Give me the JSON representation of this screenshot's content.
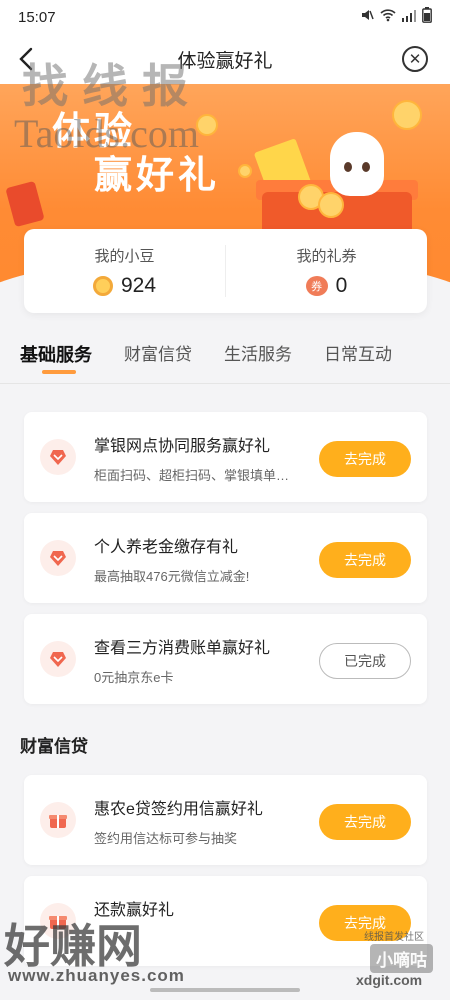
{
  "status_bar": {
    "time": "15:07",
    "battery": "▮"
  },
  "header": {
    "title": "体验赢好礼"
  },
  "banner": {
    "line1": "体验",
    "line2": "赢好礼"
  },
  "points": {
    "beans_label": "我的小豆",
    "beans_value": "924",
    "coupons_label": "我的礼券",
    "coupons_value": "0",
    "coupon_icon_text": "券"
  },
  "tabs": [
    "基础服务",
    "财富信贷",
    "生活服务",
    "日常互动"
  ],
  "tasks_basic": [
    {
      "title": "掌银网点协同服务赢好礼",
      "sub": "柜面扫码、超柜扫码、掌银填单…",
      "button": "去完成",
      "done": false
    },
    {
      "title": "个人养老金缴存有礼",
      "sub": "最高抽取476元微信立减金!",
      "button": "去完成",
      "done": false
    },
    {
      "title": "查看三方消费账单赢好礼",
      "sub": "0元抽京东e卡",
      "button": "已完成",
      "done": true
    }
  ],
  "section_wealth": "财富信贷",
  "tasks_wealth": [
    {
      "title": "惠农e贷签约用信赢好礼",
      "sub": "签约用信达标可参与抽奖",
      "button": "去完成",
      "done": false
    },
    {
      "title": "还款赢好礼",
      "sub": "",
      "button": "去完成",
      "done": false
    }
  ],
  "watermarks": {
    "top_cn": "找线报",
    "top_en": "Taolds.com",
    "bottom_cn": "好赚网",
    "bottom_url": "www.zhuanyes.com",
    "right_small": "线报首发社区",
    "right_badge": "小嘀咕",
    "right_url": "xdgit.com"
  },
  "colors": {
    "accent": "#ffaf1c",
    "banner": "#ff8b34",
    "tab_indicator": "#ff9b3d"
  },
  "icons": {
    "back": "back-arrow-icon",
    "close": "close-circle-icon",
    "task_basic": "heart-gem-icon",
    "task_wealth": "gift-icon"
  }
}
